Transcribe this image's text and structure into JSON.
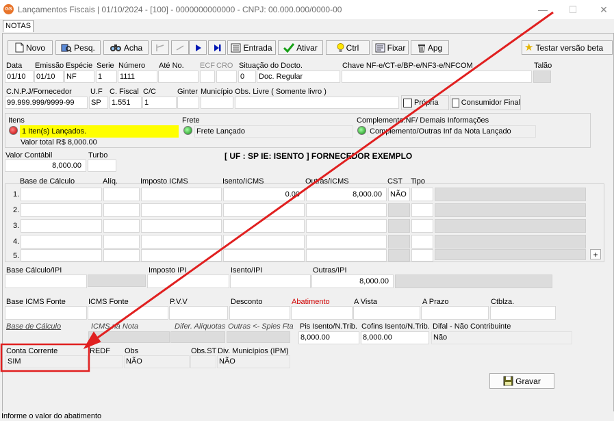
{
  "window": {
    "app_icon_text": "GS",
    "title": "Lançamentos Fiscais |  01/10/2024 - [100] - 0000000000000 - CNPJ: 00.000.000/0000-00",
    "minimize": "—",
    "maximize": "☐",
    "close": "✕"
  },
  "tabs": [
    {
      "label": "NOTAS"
    }
  ],
  "toolbar": {
    "novo": "Novo",
    "pesq": "Pesq.",
    "acha": "Acha",
    "entrada": "Entrada",
    "ativar": "Ativar",
    "ctrl": "Ctrl",
    "fixar": "Fixar",
    "apg": "Apg",
    "testar": "Testar versão beta"
  },
  "header": {
    "labels": {
      "data": "Data",
      "emissao": "Emissão",
      "especie": "Espécie",
      "serie": "Serie",
      "numero": "Número",
      "ate_no": "Até No.",
      "ecf": "ECF",
      "cro": "CRO",
      "situacao": "Situação do Docto.",
      "chave": "Chave NF-e/CT-e/BP-e/NF3-e/NFCOM",
      "talao": "Talão",
      "cnpj": "C.N.P.J/Fornecedor",
      "uf": "U.F",
      "cfiscal": "C. Fiscal",
      "cc": "C/C",
      "ginter": "Ginter",
      "municipio": "Município",
      "obs_livre": "Obs. Livre ( Somente livro )",
      "propria": "Própria",
      "consumidor": "Consumidor Final"
    },
    "values": {
      "data": "01/10",
      "emissao": "01/10",
      "especie": "NF",
      "serie": "1",
      "numero": "1111",
      "situacao_code": "0",
      "situacao_desc": "Doc. Regular",
      "cnpj": "99.999.999/9999-99",
      "uf": "SP",
      "cfiscal": "1.551",
      "cc": "1"
    }
  },
  "itens": {
    "label": "Itens",
    "status": "1 Iten(s) Lançados.",
    "total": "Valor total R$ 8,000.00",
    "frete_label": "Frete",
    "frete_status": "Frete Lançado",
    "complemento_label": "Complemento.NF/ Demais Informações",
    "complemento_status": "Complemento/Outras Inf da Nota Lançado"
  },
  "valor": {
    "contabil_label": "Valor Contábil",
    "contabil": "8,000.00",
    "turbo_label": "Turbo",
    "banner": "[ UF : SP IE: ISENTO ] FORNECEDOR EXEMPLO"
  },
  "icms_table": {
    "columns": {
      "base": "Base de Cálculo",
      "aliq": "Alíq.",
      "imposto": "Imposto ICMS",
      "isento": "Isento/ICMS",
      "outras": "Outras/ICMS",
      "cst": "CST",
      "tipo": "Tipo"
    },
    "rows": [
      {
        "n": "1.",
        "base": "",
        "aliq": "",
        "imposto": "",
        "isento": "0.00",
        "outras": "8,000.00",
        "cst": "NÃO"
      },
      {
        "n": "2.",
        "base": "",
        "aliq": "",
        "imposto": "",
        "isento": "",
        "outras": "",
        "cst": ""
      },
      {
        "n": "3.",
        "base": "",
        "aliq": "",
        "imposto": "",
        "isento": "",
        "outras": "",
        "cst": ""
      },
      {
        "n": "4.",
        "base": "",
        "aliq": "",
        "imposto": "",
        "isento": "",
        "outras": "",
        "cst": ""
      },
      {
        "n": "5.",
        "base": "",
        "aliq": "",
        "imposto": "",
        "isento": "",
        "outras": "",
        "cst": ""
      }
    ],
    "plus": "+"
  },
  "ipi": {
    "base_label": "Base Cálculo/IPI",
    "imposto_label": "Imposto IPI",
    "isento_label": "Isento/IPI",
    "outras_label": "Outras/IPI",
    "outras": "8,000.00"
  },
  "fonte": {
    "base_label": "Base ICMS Fonte",
    "icms_label": "ICMS Fonte",
    "pvv_label": "P.V.V",
    "desconto_label": "Desconto",
    "abatimento_label": "Abatimento",
    "avista_label": "A Vista",
    "aprazo_label": "A Prazo",
    "ctblza_label": "Ctblza."
  },
  "difal": {
    "base_label": "Base de Cálculo",
    "icms_nota_label": "ICMS na Nota",
    "difer_label": "Difer. Alíquotas",
    "outras_label": "Outras <- Sples Fta",
    "pis_label": "Pis Isento/N.Trib.",
    "pis": "8,000.00",
    "cofins_label": "Cofins Isento/N.Trib.",
    "cofins": "8,000.00",
    "difal_label": "Difal - Não Contribuinte",
    "difal": "Não"
  },
  "footer": {
    "conta_label": "Conta Corrente",
    "conta": "SIM",
    "redf_label": "REDF",
    "obs_label": "Obs",
    "obs": "NÃO",
    "obsst_label": "Obs.ST",
    "div_label": "Div. Municípios (IPM)",
    "div": "NÃO",
    "gravar": "Gravar"
  },
  "status_bar": "Informe o valor do abatimento",
  "colors": {
    "annotation": "#e02020",
    "highlight": "#ffff00",
    "abatimento": "#d00000"
  }
}
